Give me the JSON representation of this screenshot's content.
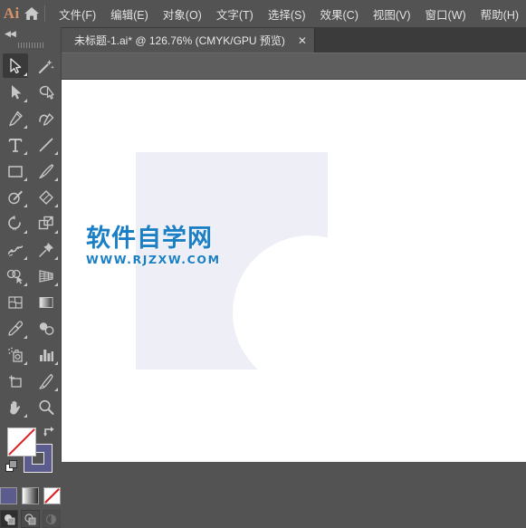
{
  "app": {
    "name": "Ai",
    "logo_color": "#d79267",
    "home_icon": "home-icon"
  },
  "menubar": {
    "items": [
      {
        "label": "文件(F)",
        "name": "menu-file"
      },
      {
        "label": "编辑(E)",
        "name": "menu-edit"
      },
      {
        "label": "对象(O)",
        "name": "menu-object"
      },
      {
        "label": "文字(T)",
        "name": "menu-type"
      },
      {
        "label": "选择(S)",
        "name": "menu-select"
      },
      {
        "label": "效果(C)",
        "name": "menu-effect"
      },
      {
        "label": "视图(V)",
        "name": "menu-view"
      },
      {
        "label": "窗口(W)",
        "name": "menu-window"
      },
      {
        "label": "帮助(H)",
        "name": "menu-help"
      }
    ]
  },
  "tabbar": {
    "document_tab": {
      "label": "未标题-1.ai* @ 126.76% (CMYK/GPU 预览)",
      "close_label": "✕",
      "active": true
    }
  },
  "toolbar": {
    "collapse_label": "◀◀",
    "tools": [
      {
        "name": "tool-selection",
        "icon": "selection-arrow-icon",
        "active": true,
        "corner": true
      },
      {
        "name": "tool-magic-wand",
        "icon": "magic-wand-icon",
        "active": false,
        "corner": false
      },
      {
        "name": "tool-direct-selection",
        "icon": "direct-selection-icon",
        "active": false,
        "corner": true
      },
      {
        "name": "tool-lasso",
        "icon": "lasso-icon",
        "active": false,
        "corner": false
      },
      {
        "name": "tool-pen",
        "icon": "pen-icon",
        "active": false,
        "corner": true
      },
      {
        "name": "tool-curvature",
        "icon": "curvature-pen-icon",
        "active": false,
        "corner": false
      },
      {
        "name": "tool-type",
        "icon": "type-t-icon",
        "active": false,
        "corner": true
      },
      {
        "name": "tool-line-segment",
        "icon": "line-segment-icon",
        "active": false,
        "corner": true
      },
      {
        "name": "tool-rectangle",
        "icon": "rectangle-icon",
        "active": false,
        "corner": true
      },
      {
        "name": "tool-paintbrush",
        "icon": "paintbrush-icon",
        "active": false,
        "corner": true
      },
      {
        "name": "tool-shaper",
        "icon": "shaper-pencil-icon",
        "active": false,
        "corner": true
      },
      {
        "name": "tool-eraser",
        "icon": "eraser-icon",
        "active": false,
        "corner": true
      },
      {
        "name": "tool-rotate",
        "icon": "rotate-icon",
        "active": false,
        "corner": true
      },
      {
        "name": "tool-scale",
        "icon": "scale-icon",
        "active": false,
        "corner": true
      },
      {
        "name": "tool-width",
        "icon": "width-warp-icon",
        "active": false,
        "corner": true
      },
      {
        "name": "tool-free-transform",
        "icon": "pushpin-icon",
        "active": false,
        "corner": true
      },
      {
        "name": "tool-shape-builder",
        "icon": "shape-builder-icon",
        "active": false,
        "corner": true
      },
      {
        "name": "tool-perspective-grid",
        "icon": "perspective-grid-icon",
        "active": false,
        "corner": true
      },
      {
        "name": "tool-mesh",
        "icon": "mesh-icon",
        "active": false,
        "corner": false
      },
      {
        "name": "tool-gradient",
        "icon": "gradient-icon",
        "active": false,
        "corner": false
      },
      {
        "name": "tool-eyedropper",
        "icon": "eyedropper-icon",
        "active": false,
        "corner": true
      },
      {
        "name": "tool-blend",
        "icon": "blend-icon",
        "active": false,
        "corner": false
      },
      {
        "name": "tool-symbol-sprayer",
        "icon": "symbol-sprayer-icon",
        "active": false,
        "corner": true
      },
      {
        "name": "tool-column-graph",
        "icon": "column-graph-icon",
        "active": false,
        "corner": true
      },
      {
        "name": "tool-artboard",
        "icon": "artboard-icon",
        "active": false,
        "corner": false
      },
      {
        "name": "tool-slice",
        "icon": "slice-knife-icon",
        "active": false,
        "corner": true
      },
      {
        "name": "tool-hand",
        "icon": "hand-icon",
        "active": false,
        "corner": true
      },
      {
        "name": "tool-zoom",
        "icon": "magnifier-icon",
        "active": false,
        "corner": false
      }
    ],
    "color_controls": {
      "fill": {
        "name": "fill-color-swatch",
        "value": "none",
        "color": "#ffffff"
      },
      "stroke": {
        "name": "stroke-color-swatch",
        "value": "purple",
        "color": "#5b5b8d"
      },
      "swap_icon": "swap-fill-stroke-icon",
      "default_icon": "default-fill-stroke-icon"
    },
    "paint_modes": [
      {
        "name": "paint-mode-color",
        "icon": "solid-color-icon",
        "active": true
      },
      {
        "name": "paint-mode-gradient",
        "icon": "gradient-swatch-icon",
        "active": false
      },
      {
        "name": "paint-mode-none",
        "icon": "none-swatch-icon",
        "active": false
      }
    ],
    "draw_modes": [
      {
        "name": "draw-mode-normal",
        "icon": "draw-normal-icon",
        "active": true,
        "enabled": true
      },
      {
        "name": "draw-mode-behind",
        "icon": "draw-behind-icon",
        "active": false,
        "enabled": true
      },
      {
        "name": "draw-mode-inside",
        "icon": "draw-inside-icon",
        "active": false,
        "enabled": false
      }
    ]
  },
  "canvas": {
    "background_color": "#ffffff",
    "artboard": {
      "name": "artboard",
      "fill_color": "#eeeef7"
    },
    "shapes": [
      {
        "name": "ellipse-shape",
        "type": "circle",
        "fill_color": "#ffffff"
      }
    ]
  },
  "watermark": {
    "title": "软件自学网",
    "url": "WWW.RJZXW.COM",
    "color": "#1a7fc4"
  }
}
